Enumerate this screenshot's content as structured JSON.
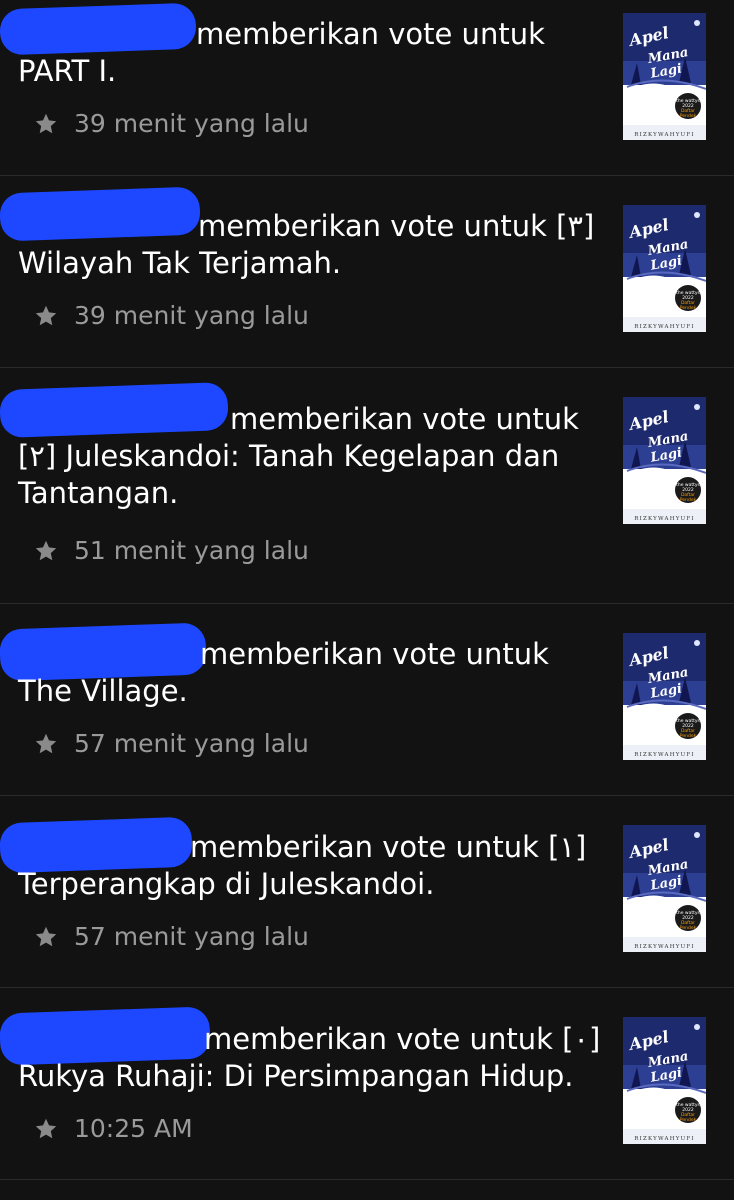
{
  "items": [
    {
      "action_text": " memberikan vote untuk ",
      "story_title": "PART I.",
      "time": "39 menit yang lalu"
    },
    {
      "action_text": " memberikan vote untuk ",
      "story_title": "[٣] Wilayah Tak Terjamah.",
      "time": "39 menit yang lalu"
    },
    {
      "action_text": " memberikan vote untuk ",
      "story_title": "[٢] Juleskandoi: Tanah Kegelapan dan Tantangan.",
      "time": "51 menit yang lalu"
    },
    {
      "action_text": " memberikan vote untuk ",
      "story_title": "The Village.",
      "time": "57 menit yang lalu"
    },
    {
      "action_text": " memberikan vote untuk ",
      "story_title": "[١] Terperangkap di Juleskandoi.",
      "time": "57 menit yang lalu"
    },
    {
      "action_text": " memberikan vote untuk ",
      "story_title": "[٠] Rukya Ruhaji: Di Persimpangan Hidup.",
      "time": "10:25 AM"
    }
  ],
  "cover": {
    "title_line1": "Apel",
    "title_line2": "Mana Lagi",
    "author": "RIZKYWAHYUFI",
    "badge_line1": "the wattys 2022",
    "badge_line2": "Daftar Pendek"
  },
  "icons": {
    "star": "star-icon",
    "redaction": "redaction-mark"
  },
  "colors": {
    "background": "#121212",
    "text": "#ffffff",
    "secondary_text": "#9a9a9a",
    "redaction": "#1d48ff",
    "divider": "#2a2a2a"
  }
}
